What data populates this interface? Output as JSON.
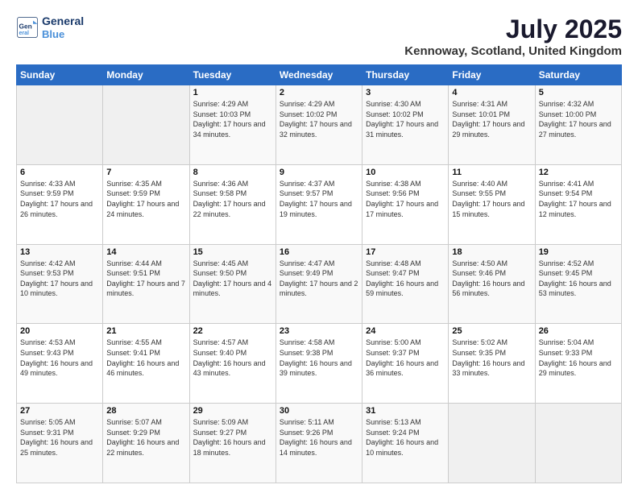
{
  "header": {
    "logo_line1": "General",
    "logo_line2": "Blue",
    "title": "July 2025",
    "location": "Kennoway, Scotland, United Kingdom"
  },
  "days_of_week": [
    "Sunday",
    "Monday",
    "Tuesday",
    "Wednesday",
    "Thursday",
    "Friday",
    "Saturday"
  ],
  "weeks": [
    [
      {
        "day": "",
        "info": ""
      },
      {
        "day": "",
        "info": ""
      },
      {
        "day": "1",
        "info": "Sunrise: 4:29 AM\nSunset: 10:03 PM\nDaylight: 17 hours and 34 minutes."
      },
      {
        "day": "2",
        "info": "Sunrise: 4:29 AM\nSunset: 10:02 PM\nDaylight: 17 hours and 32 minutes."
      },
      {
        "day": "3",
        "info": "Sunrise: 4:30 AM\nSunset: 10:02 PM\nDaylight: 17 hours and 31 minutes."
      },
      {
        "day": "4",
        "info": "Sunrise: 4:31 AM\nSunset: 10:01 PM\nDaylight: 17 hours and 29 minutes."
      },
      {
        "day": "5",
        "info": "Sunrise: 4:32 AM\nSunset: 10:00 PM\nDaylight: 17 hours and 27 minutes."
      }
    ],
    [
      {
        "day": "6",
        "info": "Sunrise: 4:33 AM\nSunset: 9:59 PM\nDaylight: 17 hours and 26 minutes."
      },
      {
        "day": "7",
        "info": "Sunrise: 4:35 AM\nSunset: 9:59 PM\nDaylight: 17 hours and 24 minutes."
      },
      {
        "day": "8",
        "info": "Sunrise: 4:36 AM\nSunset: 9:58 PM\nDaylight: 17 hours and 22 minutes."
      },
      {
        "day": "9",
        "info": "Sunrise: 4:37 AM\nSunset: 9:57 PM\nDaylight: 17 hours and 19 minutes."
      },
      {
        "day": "10",
        "info": "Sunrise: 4:38 AM\nSunset: 9:56 PM\nDaylight: 17 hours and 17 minutes."
      },
      {
        "day": "11",
        "info": "Sunrise: 4:40 AM\nSunset: 9:55 PM\nDaylight: 17 hours and 15 minutes."
      },
      {
        "day": "12",
        "info": "Sunrise: 4:41 AM\nSunset: 9:54 PM\nDaylight: 17 hours and 12 minutes."
      }
    ],
    [
      {
        "day": "13",
        "info": "Sunrise: 4:42 AM\nSunset: 9:53 PM\nDaylight: 17 hours and 10 minutes."
      },
      {
        "day": "14",
        "info": "Sunrise: 4:44 AM\nSunset: 9:51 PM\nDaylight: 17 hours and 7 minutes."
      },
      {
        "day": "15",
        "info": "Sunrise: 4:45 AM\nSunset: 9:50 PM\nDaylight: 17 hours and 4 minutes."
      },
      {
        "day": "16",
        "info": "Sunrise: 4:47 AM\nSunset: 9:49 PM\nDaylight: 17 hours and 2 minutes."
      },
      {
        "day": "17",
        "info": "Sunrise: 4:48 AM\nSunset: 9:47 PM\nDaylight: 16 hours and 59 minutes."
      },
      {
        "day": "18",
        "info": "Sunrise: 4:50 AM\nSunset: 9:46 PM\nDaylight: 16 hours and 56 minutes."
      },
      {
        "day": "19",
        "info": "Sunrise: 4:52 AM\nSunset: 9:45 PM\nDaylight: 16 hours and 53 minutes."
      }
    ],
    [
      {
        "day": "20",
        "info": "Sunrise: 4:53 AM\nSunset: 9:43 PM\nDaylight: 16 hours and 49 minutes."
      },
      {
        "day": "21",
        "info": "Sunrise: 4:55 AM\nSunset: 9:41 PM\nDaylight: 16 hours and 46 minutes."
      },
      {
        "day": "22",
        "info": "Sunrise: 4:57 AM\nSunset: 9:40 PM\nDaylight: 16 hours and 43 minutes."
      },
      {
        "day": "23",
        "info": "Sunrise: 4:58 AM\nSunset: 9:38 PM\nDaylight: 16 hours and 39 minutes."
      },
      {
        "day": "24",
        "info": "Sunrise: 5:00 AM\nSunset: 9:37 PM\nDaylight: 16 hours and 36 minutes."
      },
      {
        "day": "25",
        "info": "Sunrise: 5:02 AM\nSunset: 9:35 PM\nDaylight: 16 hours and 33 minutes."
      },
      {
        "day": "26",
        "info": "Sunrise: 5:04 AM\nSunset: 9:33 PM\nDaylight: 16 hours and 29 minutes."
      }
    ],
    [
      {
        "day": "27",
        "info": "Sunrise: 5:05 AM\nSunset: 9:31 PM\nDaylight: 16 hours and 25 minutes."
      },
      {
        "day": "28",
        "info": "Sunrise: 5:07 AM\nSunset: 9:29 PM\nDaylight: 16 hours and 22 minutes."
      },
      {
        "day": "29",
        "info": "Sunrise: 5:09 AM\nSunset: 9:27 PM\nDaylight: 16 hours and 18 minutes."
      },
      {
        "day": "30",
        "info": "Sunrise: 5:11 AM\nSunset: 9:26 PM\nDaylight: 16 hours and 14 minutes."
      },
      {
        "day": "31",
        "info": "Sunrise: 5:13 AM\nSunset: 9:24 PM\nDaylight: 16 hours and 10 minutes."
      },
      {
        "day": "",
        "info": ""
      },
      {
        "day": "",
        "info": ""
      }
    ]
  ]
}
